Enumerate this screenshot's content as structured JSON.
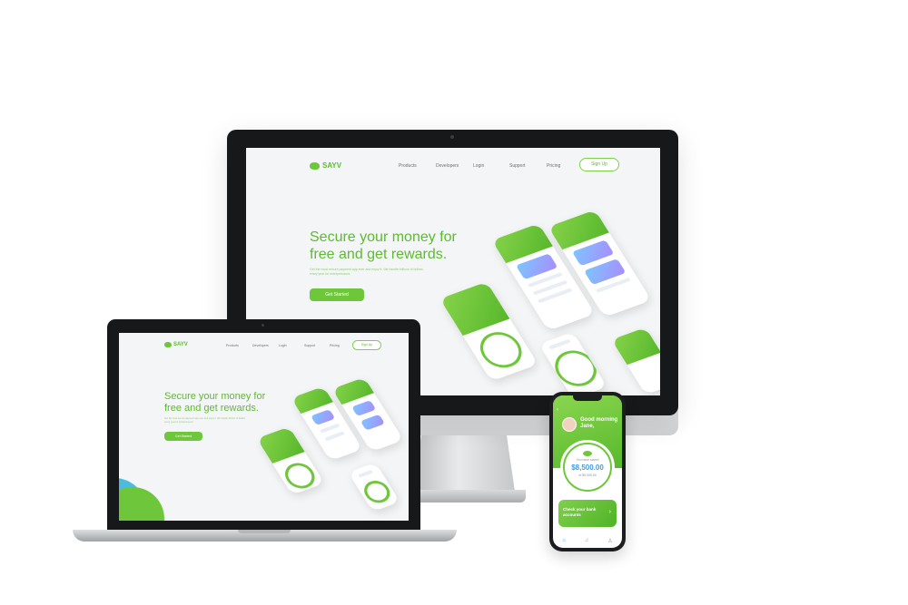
{
  "site": {
    "brand": "SAYV",
    "nav": [
      "Products",
      "Developers",
      "Login",
      "Support",
      "Pricing"
    ],
    "signup_label": "Sign Up",
    "headline_line1": "Secure your money for",
    "headline_line2": "free and get rewards.",
    "subtext": "Get the most secure payment app ever and enjoy it. We handle billions of dollars every year for entrepreneurs.",
    "cta_label": "Get Started"
  },
  "phone": {
    "back_label": "‹",
    "greeting": "Good morning Jane,",
    "saved_label": "You have saved",
    "saved_amount": "$8,500.00",
    "saved_of": "of $9,000.00",
    "check_label": "Check your bank accounts",
    "chevron": "›",
    "tabs": [
      "⌂",
      "♫",
      "♙"
    ]
  },
  "colors": {
    "brand_green": "#6ec73a",
    "accent_blue": "#3aa0e8"
  }
}
